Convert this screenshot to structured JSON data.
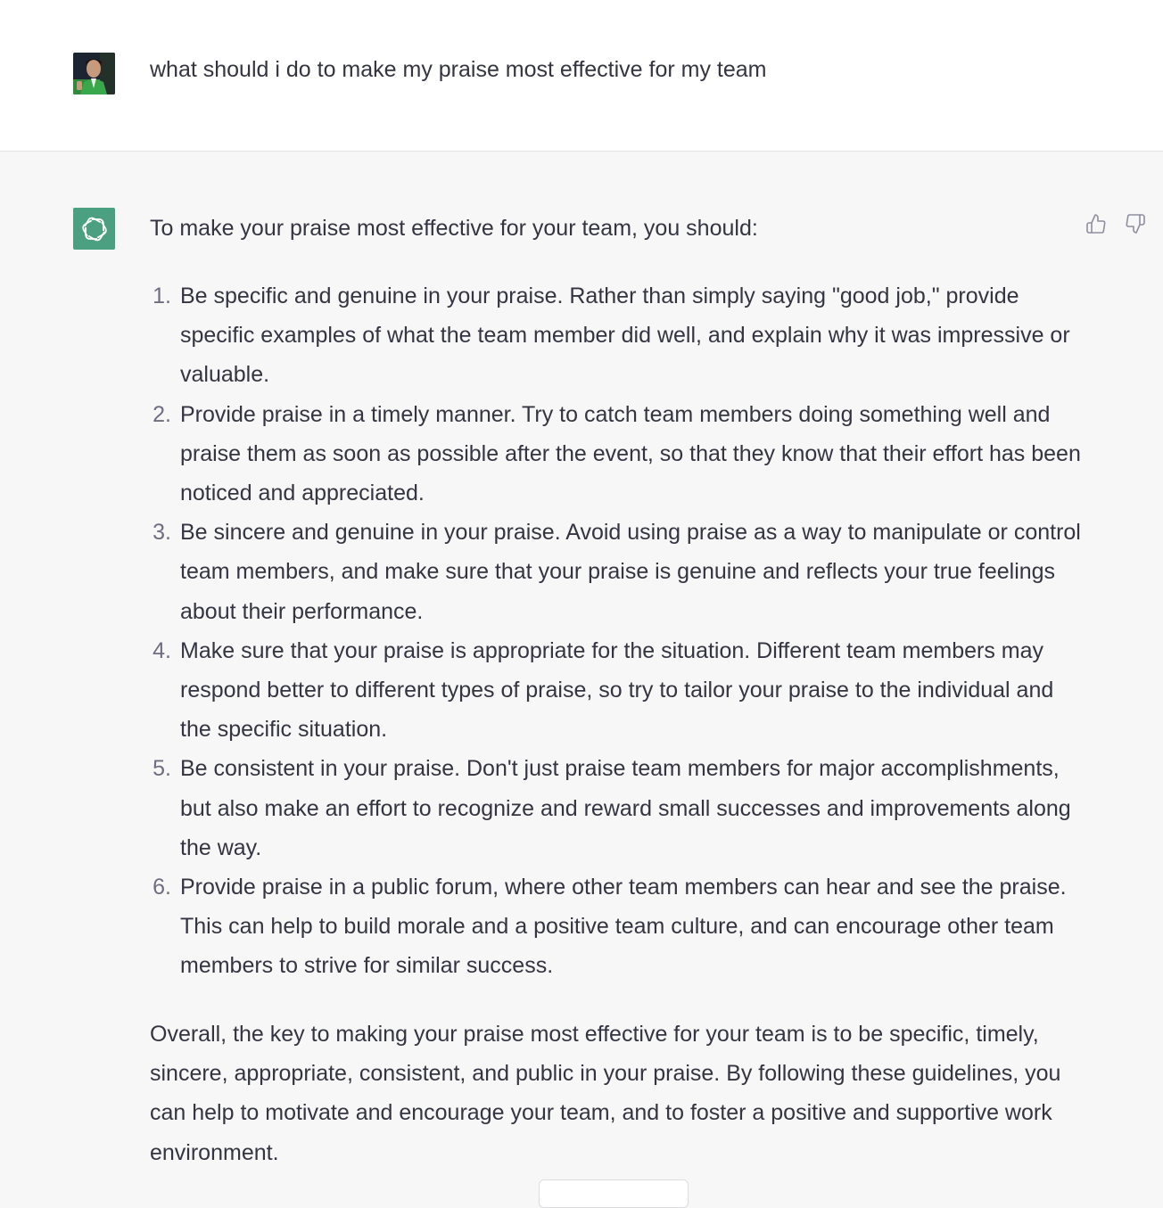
{
  "user_message": {
    "text": "what should i do to make my praise most effective for my team"
  },
  "assistant_message": {
    "intro": "To make your praise most effective for your team, you should:",
    "items": [
      {
        "num": "1.",
        "text": "Be specific and genuine in your praise. Rather than simply saying \"good job,\" provide specific examples of what the team member did well, and explain why it was impressive or valuable."
      },
      {
        "num": "2.",
        "text": "Provide praise in a timely manner. Try to catch team members doing something well and praise them as soon as possible after the event, so that they know that their effort has been noticed and appreciated."
      },
      {
        "num": "3.",
        "text": "Be sincere and genuine in your praise. Avoid using praise as a way to manipulate or control team members, and make sure that your praise is genuine and reflects your true feelings about their performance."
      },
      {
        "num": "4.",
        "text": "Make sure that your praise is appropriate for the situation. Different team members may respond better to different types of praise, so try to tailor your praise to the individual and the specific situation."
      },
      {
        "num": "5.",
        "text": "Be consistent in your praise. Don't just praise team members for major accomplishments, but also make an effort to recognize and reward small successes and improvements along the way."
      },
      {
        "num": "6.",
        "text": "Provide praise in a public forum, where other team members can hear and see the praise. This can help to build morale and a positive team culture, and can encourage other team members to strive for similar success."
      }
    ],
    "conclusion": "Overall, the key to making your praise most effective for your team is to be specific, timely, sincere, appropriate, consistent, and public in your praise. By following these guidelines, you can help to motivate and encourage your team, and to foster a positive and supportive work environment."
  },
  "icons": {
    "user_avatar": "user-avatar",
    "assistant_avatar": "openai-logo-icon",
    "thumbs_up": "thumbs-up-icon",
    "thumbs_down": "thumbs-down-icon"
  },
  "colors": {
    "assistant_bg": "#f7f7f8",
    "user_bg": "#ffffff",
    "logo_bg": "#4aa081",
    "text": "#343541"
  }
}
